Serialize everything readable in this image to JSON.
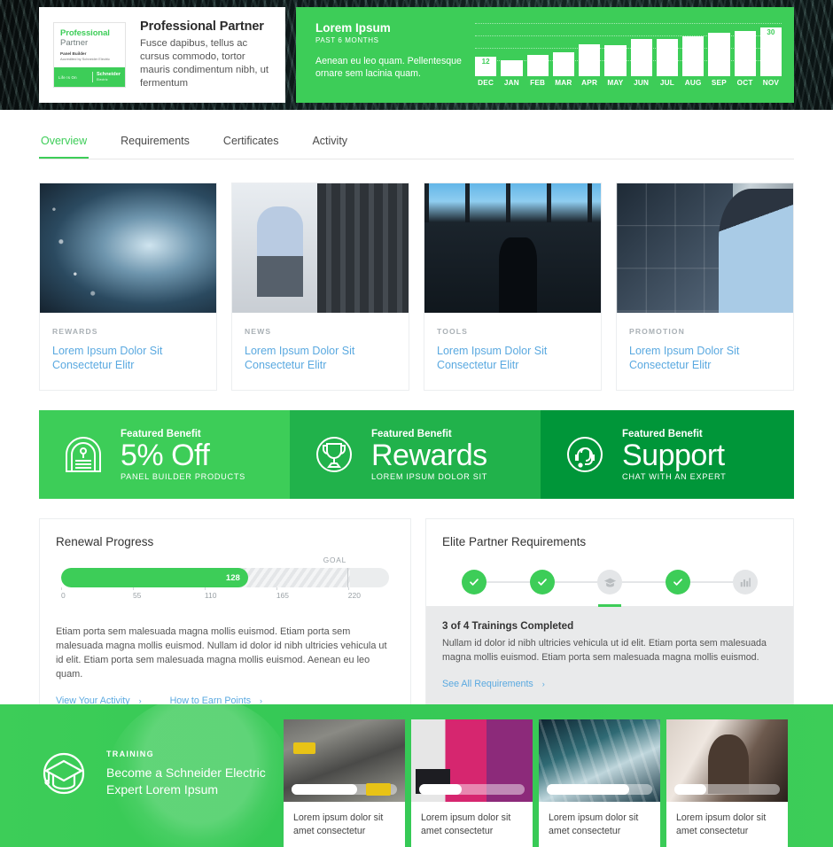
{
  "colors": {
    "brand_green": "#3dcd58",
    "green_mid": "#21b24b",
    "green_dark": "#009639",
    "link_blue": "#5aa9e0",
    "text_dark": "#333333",
    "muted": "#a9b0b5"
  },
  "header": {
    "badge": {
      "line1": "Professional",
      "line2": "Partner",
      "line3": "Panel Builder",
      "line4": "Accredited by Schneider Electric",
      "tagline": "Life Is On",
      "brand": "Schneider",
      "brand_sub": "Electric"
    },
    "partner_title": "Professional Partner",
    "partner_desc": "Fusce dapibus, tellus ac cursus commodo, tortor mauris condimentum nibh, ut fermentum"
  },
  "stats": {
    "title": "Lorem Ipsum",
    "subtitle": "PAST 6 MONTHS",
    "body": "Aenean eu leo quam. Pellentesque ornare sem lacinia quam."
  },
  "chart_data": {
    "type": "bar",
    "title": "Lorem Ipsum",
    "subtitle": "PAST 6 MONTHS",
    "categories": [
      "DEC",
      "JAN",
      "FEB",
      "MAR",
      "APR",
      "MAY",
      "JUN",
      "JUL",
      "AUG",
      "SEP",
      "OCT",
      "NOV"
    ],
    "values": [
      12,
      10,
      13,
      15,
      20,
      19,
      23,
      23,
      25,
      27,
      28,
      30
    ],
    "labeled_points": [
      {
        "category": "DEC",
        "value": 12
      },
      {
        "category": "NOV",
        "value": 30
      }
    ],
    "ylim": [
      0,
      33
    ],
    "grid": true,
    "gridlines": 4,
    "xlabel": "",
    "ylabel": "",
    "legend": "none",
    "bar_color": "#ffffff",
    "background": "#3dcd58"
  },
  "tabs": [
    {
      "label": "Overview",
      "active": true
    },
    {
      "label": "Requirements",
      "active": false
    },
    {
      "label": "Certificates",
      "active": false
    },
    {
      "label": "Activity",
      "active": false
    }
  ],
  "cards": [
    {
      "kicker": "REWARDS",
      "title": "Lorem Ipsum Dolor Sit Consectetur Elitr",
      "image": "turbine-blade-photo"
    },
    {
      "kicker": "NEWS",
      "title": "Lorem Ipsum Dolor Sit Consectetur Elitr",
      "image": "two-men-tablet-datacenter-photo"
    },
    {
      "kicker": "TOOLS",
      "title": "Lorem Ipsum Dolor Sit Consectetur Elitr",
      "image": "silhouette-window-photo"
    },
    {
      "kicker": "PROMOTION",
      "title": "Lorem Ipsum Dolor Sit Consectetur Elitr",
      "image": "control-room-screens-photo"
    }
  ],
  "benefits": [
    {
      "kicker": "Featured Benefit",
      "main": "5% Off",
      "sub": "PANEL BUILDER PRODUCTS",
      "icon": "tag-badge-icon"
    },
    {
      "kicker": "Featured Benefit",
      "main": "Rewards",
      "sub": "LOREM IPSUM DOLOR SIT",
      "icon": "trophy-icon"
    },
    {
      "kicker": "Featured Benefit",
      "main": "Support",
      "sub": "CHAT WITH AN EXPERT",
      "icon": "headset-agent-icon"
    }
  ],
  "renewal": {
    "title": "Renewal Progress",
    "goal_label": "GOAL",
    "current_value": "128",
    "ticks": [
      "0",
      "55",
      "110",
      "165",
      "220"
    ],
    "body": "Etiam porta sem malesuada magna mollis euismod. Etiam porta sem malesuada magna mollis euismod. Nullam id dolor id nibh ultricies vehicula ut id elit. Etiam porta sem malesuada magna mollis euismod. Aenean eu leo quam.",
    "links": [
      {
        "label": "View Your Activity",
        "chevron": "›"
      },
      {
        "label": "How to Earn Points",
        "chevron": "›"
      }
    ]
  },
  "requirements": {
    "title": "Elite Partner Requirements",
    "steps": [
      {
        "state": "done",
        "icon": "check-icon"
      },
      {
        "state": "done",
        "icon": "check-icon"
      },
      {
        "state": "active",
        "icon": "graduation-cap-icon"
      },
      {
        "state": "done",
        "icon": "check-icon"
      },
      {
        "state": "pending",
        "icon": "bar-chart-icon"
      }
    ],
    "status_title": "3 of 4 Trainings Completed",
    "status_desc": "Nullam id dolor id nibh ultricies vehicula ut id elit. Etiam porta sem malesuada magna mollis euismod. Etiam porta sem malesuada magna mollis euismod.",
    "link": {
      "label": "See All Requirements",
      "chevron": "›"
    }
  },
  "training": {
    "kicker": "TRAINING",
    "title": "Become a Schneider Electric Expert Lorem Ipsum",
    "icon": "graduation-cap-icon",
    "cards": [
      {
        "text": "Lorem ipsum dolor sit amet consectetur",
        "progress": 62,
        "image": "city-intersection-photo"
      },
      {
        "text": "Lorem ipsum dolor sit amet consectetur",
        "progress": 40,
        "image": "pink-room-woman-photo"
      },
      {
        "text": "Lorem ipsum dolor sit amet consectetur",
        "progress": 78,
        "image": "escalator-photo"
      },
      {
        "text": "Lorem ipsum dolor sit amet consectetur",
        "progress": 30,
        "image": "man-thinking-photo"
      }
    ]
  }
}
